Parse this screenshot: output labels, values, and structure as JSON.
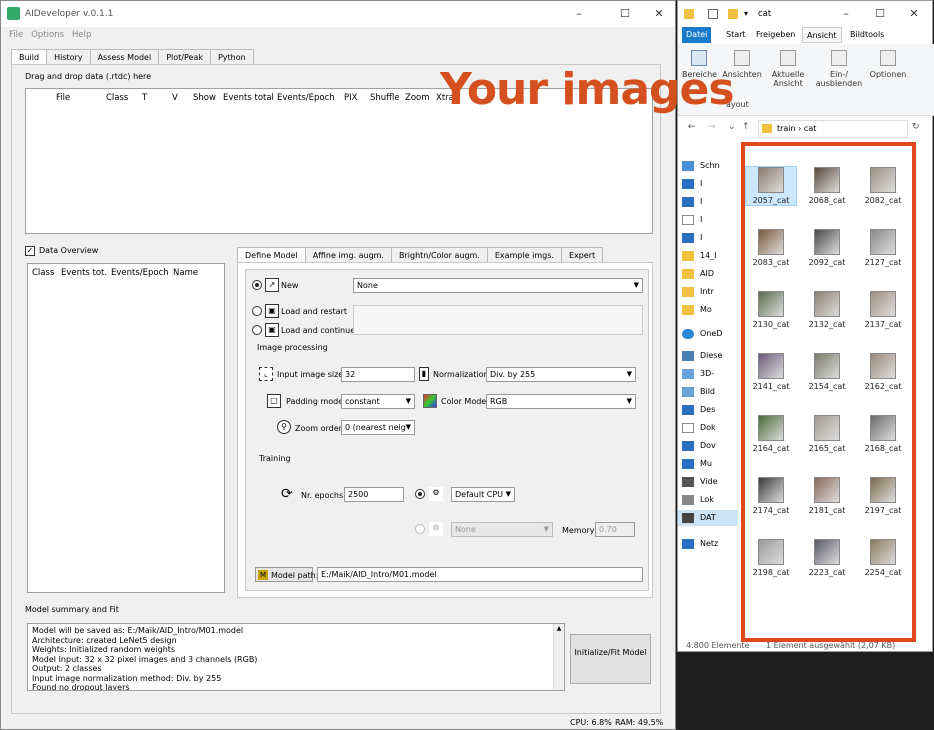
{
  "aid": {
    "title": "AIDeveloper v.0.1.1",
    "menu": [
      "File",
      "Options",
      "Help"
    ],
    "tabs": [
      "Build",
      "History",
      "Assess Model",
      "Plot/Peak",
      "Python"
    ],
    "drag_label": "Drag and drop data (.rtdc) here",
    "data_columns": [
      "File",
      "Class",
      "T",
      "V",
      "Show",
      "Events total",
      "Events/Epoch",
      "PIX",
      "Shuffle",
      "Zoom",
      "Xtra"
    ],
    "overview_label": "Data Overview",
    "overview_columns": [
      "Class",
      "Events tot.",
      "Events/Epoch",
      "Name"
    ],
    "model_tabs": [
      "Define Model",
      "Affine img. augm.",
      "Brightn/Color augm.",
      "Example imgs.",
      "Expert"
    ],
    "new_label": "New",
    "new_value": "None",
    "load_restart": "Load and restart",
    "load_continue": "Load and continue",
    "image_processing": "Image processing",
    "input_size_label": "Input image size",
    "input_size": "32",
    "normalization_label": "Normalization",
    "normalization": "Div. by 255",
    "padding_label": "Padding mode",
    "padding": "constant",
    "color_mode_label": "Color Mode",
    "color_mode": "RGB",
    "zoom_label": "Zoom order",
    "zoom": "0 (nearest neigh",
    "training": "Training",
    "epochs_label": "Nr. epochs",
    "epochs": "2500",
    "device": "Default CPU",
    "device2": "None",
    "memory_label": "Memory",
    "memory": "0.70",
    "model_path_label": "Model path:",
    "model_path": "E:/Maik/AID_Intro/M01.model",
    "summary_label": "Model summary and Fit",
    "summary_lines": [
      "Model will be saved as: E:/Maik/AID_Intro/M01.model",
      "Architecture: created LeNet5 design",
      "Weights: Initialized random weights",
      "Model Input: 32 x 32 pixel images and 3 channels (RGB)",
      "Output: 2 classes",
      "Input image normalization method: Div. by 255",
      "Found no dropout layers"
    ],
    "fit_button": "Initialize/Fit Model",
    "cpu": "CPU: 6.8%",
    "ram": "RAM: 49.5%"
  },
  "explorer": {
    "title": "cat",
    "ribbon_tabs": [
      "Datei",
      "Start",
      "Freigeben",
      "Ansicht",
      "Bildtools"
    ],
    "ribbon_items": [
      "Bereiche",
      "Ansichten",
      "Aktuelle Ansicht",
      "Ein-/ ausblenden",
      "Optionen",
      "ayout"
    ],
    "path": [
      "train",
      "cat"
    ],
    "tree": [
      "Schn",
      "I",
      "I",
      "I",
      "I",
      "14_I",
      "AID",
      "Intr",
      "Mo",
      "OneD",
      "Diese",
      "3D-",
      "Bild",
      "Des",
      "Dok",
      "Dov",
      "Mu",
      "Vide",
      "Lok",
      "DAT",
      "Netz"
    ],
    "files": [
      "2057_cat",
      "2068_cat",
      "2082_cat",
      "2083_cat",
      "2092_cat",
      "2127_cat",
      "2130_cat",
      "2132_cat",
      "2137_cat",
      "2141_cat",
      "2154_cat",
      "2162_cat",
      "2164_cat",
      "2165_cat",
      "2168_cat",
      "2174_cat",
      "2181_cat",
      "2197_cat",
      "2198_cat",
      "2223_cat",
      "2254_cat"
    ],
    "status_count": "4.800 Elemente",
    "status_selected": "1 Element ausgewählt (2,07 KB)"
  },
  "overlay": {
    "text": "Your images",
    "color": "#d4501e"
  }
}
